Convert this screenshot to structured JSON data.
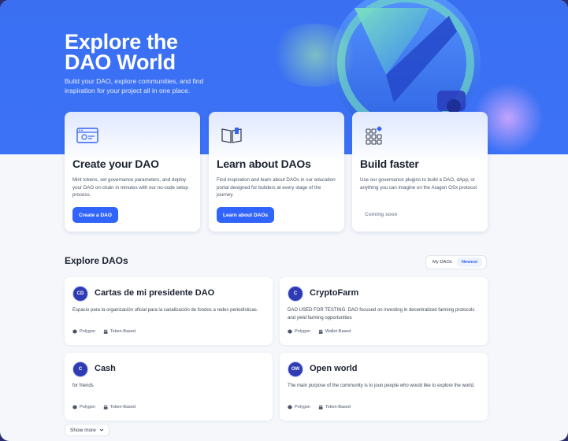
{
  "hero": {
    "title_line1": "Explore the",
    "title_line2": "DAO World",
    "subtitle": "Build your DAO, explore communities, and find inspiration for your project all in one place."
  },
  "cards": [
    {
      "title": "Create your DAO",
      "description": "Mint tokens, set governance parameters, and deploy your DAO on-chain in minutes with our no-code setup process.",
      "button": "Create a DAO",
      "icon": "browser-window-icon"
    },
    {
      "title": "Learn about DAOs",
      "description": "Find inspiration and learn about DAOs in our education portal designed for builders at every stage of the journey.",
      "button": "Learn about DAOs",
      "icon": "open-book-icon"
    },
    {
      "title": "Build faster",
      "description": "Use our governance plugins to build a DAO, dApp, or anything you can imagine on the Aragon OSx protocol.",
      "status": "Coming soon",
      "icon": "grid-blocks-icon"
    }
  ],
  "explore": {
    "title": "Explore DAOs",
    "toggle": [
      "My DAOs",
      "Newest"
    ],
    "active_toggle": "Newest",
    "show_more": "Show more"
  },
  "daos": [
    {
      "avatar": "CD",
      "name": "Cartas de mi presidente DAO",
      "description": "Espacio para la organización oficial para la canalización de fondos a redes periodísticas.",
      "network": "Polygon",
      "governance": "Token-Based"
    },
    {
      "avatar": "C",
      "name": "CryptoFarm",
      "description": "DAO USED FOR TESTING. DAO focused on investing in decentralized farming protocols and yield farming opportunities",
      "network": "Polygon",
      "governance": "Wallet-Based"
    },
    {
      "avatar": "C",
      "name": "Cash",
      "description": "for friends",
      "network": "Polygon",
      "governance": "Token-Based"
    },
    {
      "avatar": "OW",
      "name": "Open world",
      "description": "The main purpose of the community is to joun people who would like to explore the world.",
      "network": "Polygon",
      "governance": "Token-Based"
    }
  ],
  "colors": {
    "hero_blue": "#3c72f6",
    "primary_button": "#3164fa",
    "avatar_bg": "#2f3bb3"
  }
}
